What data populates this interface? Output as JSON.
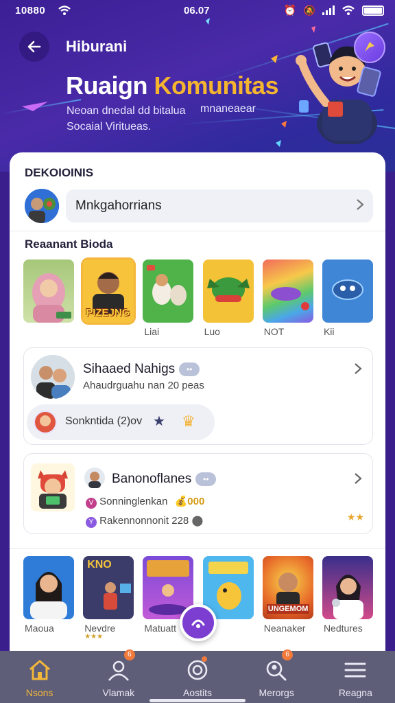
{
  "status_bar": {
    "time_left": "10880",
    "time_center": "06.07"
  },
  "header": {
    "title": "Hiburani",
    "heading_part1": "Ruaign",
    "heading_part2": "Komunitas",
    "subtitle_line1": "Neoan dnedal dd bitalua",
    "subtitle_line2": "Socaial Viritueas.",
    "subtitle_extra": "mnaneaear"
  },
  "sections": {
    "top_label": "DEKOIOINIS",
    "profile_pill": "Mnkgahorrians",
    "recent_label": "Reaanant Bioda"
  },
  "thumbs_row1": [
    {
      "caption": "",
      "name": "woman-hijab"
    },
    {
      "caption": "",
      "name": "man-game",
      "overlay": "PIZEJNG"
    },
    {
      "caption": "Liai",
      "name": "cows-cartoon"
    },
    {
      "caption": "Luo",
      "name": "green-creature"
    },
    {
      "caption": "NOT",
      "name": "rainbow-whale"
    },
    {
      "caption": "Kii",
      "name": "blue-robot"
    }
  ],
  "card_a": {
    "title": "Sihaaed Nahigs",
    "badge": "••",
    "subtitle": "Ahaudrguahu nan 20 peas",
    "pill_text": "Sonkntida (2)ov"
  },
  "card_b": {
    "title": "Banonoflanes",
    "badge": "••",
    "line1": "Sonninglenkan",
    "line1_coins": "💰000",
    "line2": "Rakennonnonit 228"
  },
  "thumbs_row2": [
    {
      "caption": "Maoua"
    },
    {
      "caption": "Nevdre",
      "overlay": "KNO"
    },
    {
      "caption": "Matuatt"
    },
    {
      "caption": ""
    },
    {
      "caption": "Neanaker",
      "overlay": "UNGEMOM"
    },
    {
      "caption": "Nedtures"
    }
  ],
  "nav": {
    "items": [
      {
        "label": "Nsons",
        "icon": "home-icon",
        "active": true
      },
      {
        "label": "Vlamak",
        "icon": "person-icon",
        "badge": "6"
      },
      {
        "label": "Aostits",
        "icon": "target-icon",
        "badge": ""
      },
      {
        "label": "Merorgs",
        "icon": "search-person-icon",
        "badge": "6"
      },
      {
        "label": "Reagna",
        "icon": "menu-icon"
      }
    ]
  },
  "colors": {
    "primary": "#4a2aa8",
    "accent": "#f5b52e",
    "nav_bg": "#5e5e78"
  }
}
